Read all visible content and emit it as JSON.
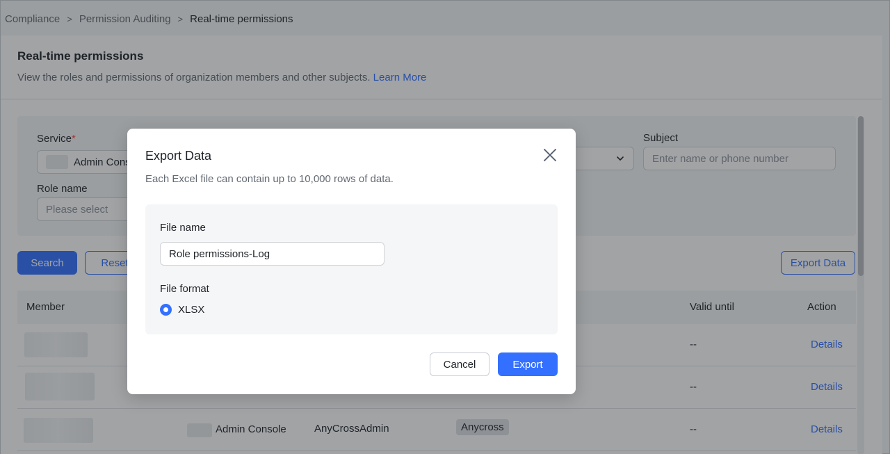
{
  "breadcrumb": {
    "items": [
      "Compliance",
      "Permission Auditing",
      "Real-time permissions"
    ],
    "separator": ">"
  },
  "header": {
    "title": "Real-time permissions",
    "description": "View the roles and permissions of organization members and other subjects.",
    "learn_more": "Learn More"
  },
  "filters": {
    "service_label": "Service",
    "required_mark": "*",
    "service_value": "Admin Cons",
    "role_label": "Role name",
    "role_placeholder": "Please select",
    "subject_label": "Subject",
    "subject_placeholder": "Enter name or phone number"
  },
  "actions": {
    "search": "Search",
    "reset": "Reset",
    "export_data": "Export Data"
  },
  "table": {
    "columns": {
      "member": "Member",
      "valid_until": "Valid until",
      "action": "Action"
    },
    "rows": [
      {
        "service": "",
        "role": "",
        "tag": "",
        "valid_until": "--",
        "action": "Details"
      },
      {
        "service": "",
        "role": "",
        "tag": "",
        "valid_until": "--",
        "action": "Details"
      },
      {
        "service": "Admin Console",
        "role": "AnyCrossAdmin",
        "tag": "Anycross",
        "valid_until": "--",
        "action": "Details"
      }
    ]
  },
  "modal": {
    "title": "Export Data",
    "description": "Each Excel file can contain up to 10,000 rows of data.",
    "file_name_label": "File name",
    "file_name_value": "Role permissions-Log",
    "file_format_label": "File format",
    "format_option": "XLSX",
    "cancel": "Cancel",
    "export": "Export"
  },
  "colors": {
    "primary": "#3370ff",
    "required": "#f54a45"
  },
  "icons": {
    "close": "close-icon",
    "chevron": "chevron-down-icon",
    "breadcrumb_separator": "chevron-right-icon"
  }
}
